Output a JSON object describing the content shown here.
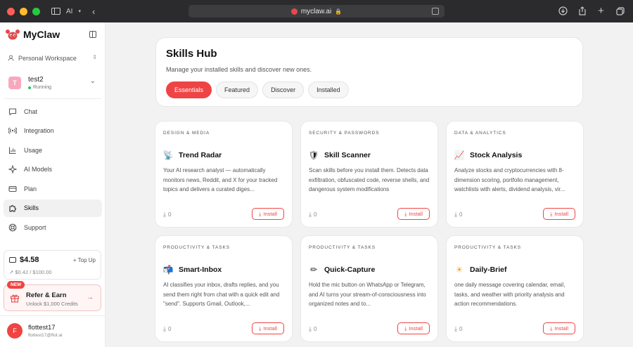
{
  "browser": {
    "tab_group_label": "AI",
    "url": "myclaw.ai"
  },
  "sidebar": {
    "brand": "MyClaw",
    "workspace": "Personal Workspace",
    "instance": {
      "avatar": "T",
      "name": "test2",
      "status": "Running"
    },
    "nav": [
      {
        "label": "Chat",
        "icon": "chat-icon",
        "active": false
      },
      {
        "label": "Integration",
        "icon": "broadcast-icon",
        "active": false
      },
      {
        "label": "Usage",
        "icon": "bar-chart-icon",
        "active": false
      },
      {
        "label": "AI Models",
        "icon": "sparkle-icon",
        "active": false
      },
      {
        "label": "Plan",
        "icon": "card-icon",
        "active": false
      },
      {
        "label": "Skills",
        "icon": "puzzle-icon",
        "active": true
      },
      {
        "label": "Support",
        "icon": "lifebuoy-icon",
        "active": false
      }
    ],
    "credits": {
      "amount": "$4.58",
      "top_up": "+ Top Up",
      "usage": "$0.42 / $100.00"
    },
    "refer": {
      "badge": "NEW",
      "title": "Refer & Earn",
      "subtitle": "Unlock $1,000 Credits"
    },
    "user": {
      "avatar": "F",
      "name": "flottest17",
      "email": "flottest17@flot.ai"
    }
  },
  "hub": {
    "title": "Skills Hub",
    "subtitle": "Manage your installed skills and discover new ones.",
    "tabs": [
      {
        "label": "Essentials",
        "active": true
      },
      {
        "label": "Featured",
        "active": false
      },
      {
        "label": "Discover",
        "active": false
      },
      {
        "label": "Installed",
        "active": false
      }
    ]
  },
  "install_label": "Install",
  "skills": [
    {
      "category": "DESIGN & MEDIA",
      "emoji": "📡",
      "name": "Trend Radar",
      "description": "Your AI research analyst — automatically monitors news, Reddit, and X for your tracked topics and delivers a curated diges...",
      "installs": "0"
    },
    {
      "category": "SECURITY & PASSWORDS",
      "emoji": "🛡",
      "name": "Skill Scanner",
      "description": "Scan skills before you install them. Detects data exfiltration, obfuscated code, reverse shells, and dangerous system modifications",
      "installs": "0"
    },
    {
      "category": "DATA & ANALYTICS",
      "emoji": "📈",
      "name": "Stock Analysis",
      "description": "Analyze stocks and cryptocurrencies with 8-dimension scoring, portfolio management, watchlists with alerts, dividend analysis, vir...",
      "installs": "0"
    },
    {
      "category": "PRODUCTIVITY & TASKS",
      "emoji": "📬",
      "name": "Smart-Inbox",
      "description": "AI classifies your inbox, drafts replies, and you send them right from chat with a quick edit and \"send\". Supports Gmail, Outlook,...",
      "installs": "0"
    },
    {
      "category": "PRODUCTIVITY & TASKS",
      "emoji": "✏",
      "name": "Quick-Capture",
      "description": "Hold the mic button on WhatsApp or Telegram, and AI turns your stream-of-consciousness into organized notes and to...",
      "installs": "0"
    },
    {
      "category": "PRODUCTIVITY & TASKS",
      "emoji": "☀",
      "name": "Daily-Brief",
      "description": "one daily message covering calendar, email, tasks, and weather with priority analysis and action recommendations.",
      "installs": "0"
    }
  ],
  "colors": {
    "accent": "#ef4444",
    "sidebar_bg": "#ffffff",
    "main_bg": "#f2f2f3"
  }
}
